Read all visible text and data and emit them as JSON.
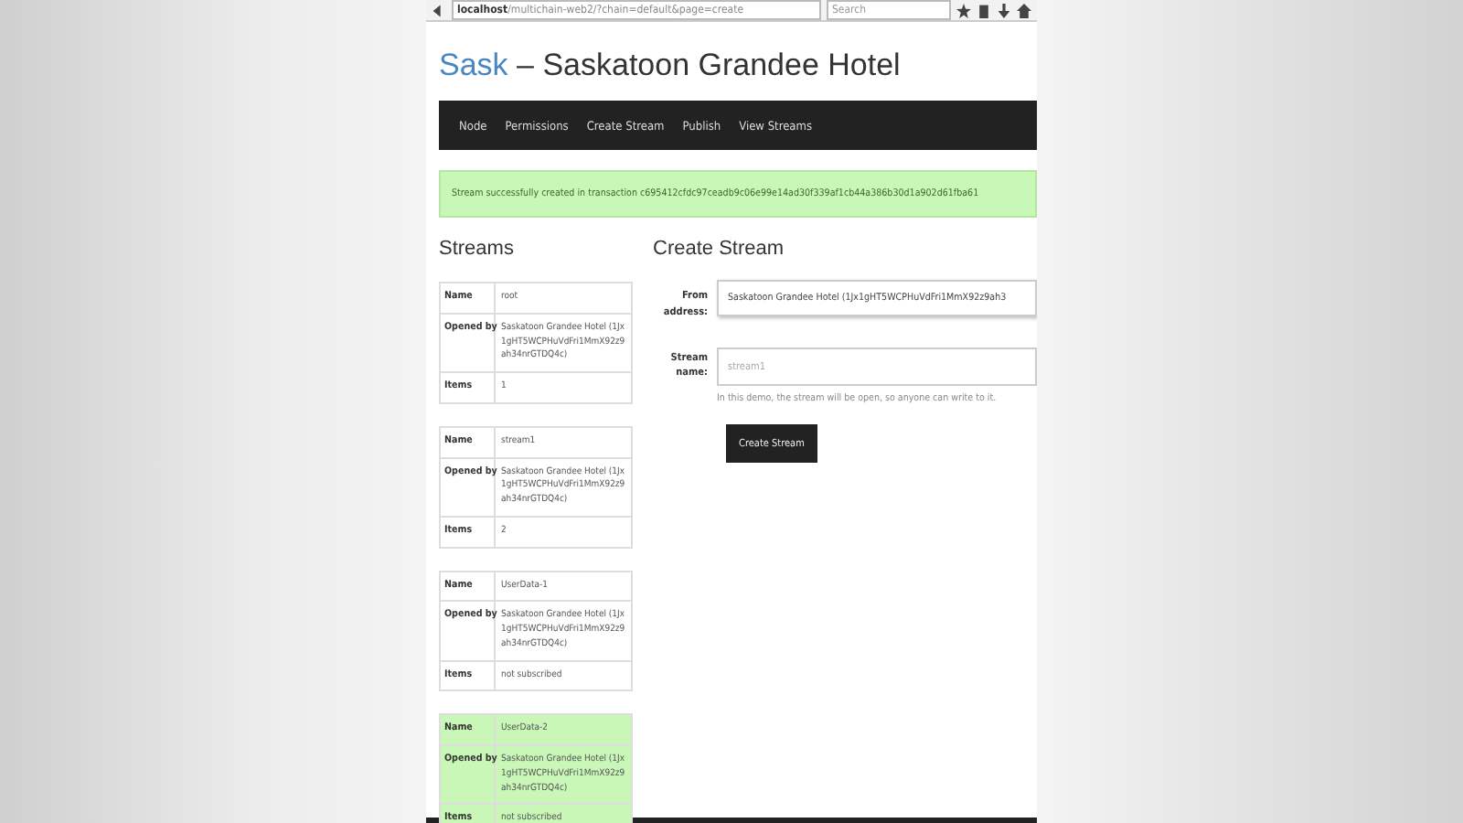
{
  "browser": {
    "url": "**localhost**/multichain-web2/?chain=default&page=create",
    "search_placeholder": "Search"
  },
  "header": {
    "brand": "Sask",
    "title": "– Saskatoon Grandee Hotel"
  },
  "nav": [
    {
      "label": "Node"
    },
    {
      "label": "Permissions"
    },
    {
      "label": "Create Stream"
    },
    {
      "label": "Publish"
    },
    {
      "label": "View Streams"
    }
  ],
  "alert": "Stream successfully created in transaction c695412cfdc97ceadb9c06e99e14ad30f339af1cb44a386b30d1a902d61fba61",
  "streams": {
    "heading": "Streams",
    "items": [
      {
        "highlighted": false,
        "rows": [
          {
            "label": "Name",
            "value": "root"
          },
          {
            "label": "Opened by",
            "value": "Saskatoon Grandee Hotel (1Jx1gHT5WCPHuVdFri1MmX92z9ah34nrGTDQ4c)"
          },
          {
            "label": "Items",
            "value": "1"
          }
        ]
      },
      {
        "highlighted": false,
        "rows": [
          {
            "label": "Name",
            "value": "stream1"
          },
          {
            "label": "Opened by",
            "value": "Saskatoon Grandee Hotel (1Jx1gHT5WCPHuVdFri1MmX92z9ah34nrGTDQ4c)"
          },
          {
            "label": "Items",
            "value": "2"
          }
        ]
      },
      {
        "highlighted": false,
        "rows": [
          {
            "label": "Name",
            "value": "UserData-1"
          },
          {
            "label": "Opened by",
            "value": "Saskatoon Grandee Hotel (1Jx1gHT5WCPHuVdFri1MmX92z9ah34nrGTDQ4c)"
          },
          {
            "label": "Items",
            "value": "not subscribed"
          }
        ]
      },
      {
        "highlighted": true,
        "rows": [
          {
            "label": "Name",
            "value": "UserData-2"
          },
          {
            "label": "Opened by",
            "value": "Saskatoon Grandee Hotel (1Jx1gHT5WCPHuVdFri1MmX92z9ah34nrGTDQ4c)"
          },
          {
            "label": "Items",
            "value": "not subscribed"
          }
        ]
      }
    ]
  },
  "form": {
    "heading": "Create Stream",
    "from_label": "From address:",
    "from_value": "Saskatoon Grandee Hotel (1Jx1gHT5WCPHuVdFri1MmX92z9ah3",
    "name_label": "Stream name:",
    "name_placeholder": "stream1",
    "help": "In this demo, the stream will be open, so anyone can write to it.",
    "button": "Create Stream"
  }
}
